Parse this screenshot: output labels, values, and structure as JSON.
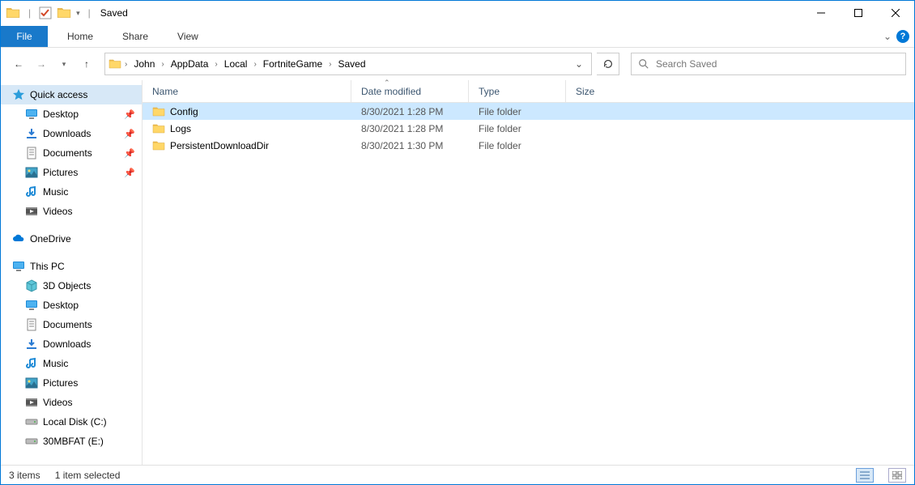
{
  "titlebar": {
    "title": "Saved",
    "sep": "|"
  },
  "ribbon": {
    "file": "File",
    "tabs": [
      "Home",
      "Share",
      "View"
    ]
  },
  "breadcrumb": [
    "John",
    "AppData",
    "Local",
    "FortniteGame",
    "Saved"
  ],
  "search": {
    "placeholder": "Search Saved"
  },
  "navpane": {
    "quick_access": "Quick access",
    "quick_items": [
      {
        "label": "Desktop",
        "icon": "desktop",
        "pinned": true
      },
      {
        "label": "Downloads",
        "icon": "downloads",
        "pinned": true
      },
      {
        "label": "Documents",
        "icon": "documents",
        "pinned": true
      },
      {
        "label": "Pictures",
        "icon": "pictures",
        "pinned": true
      },
      {
        "label": "Music",
        "icon": "music",
        "pinned": false
      },
      {
        "label": "Videos",
        "icon": "videos",
        "pinned": false
      }
    ],
    "onedrive": "OneDrive",
    "this_pc": "This PC",
    "pc_items": [
      {
        "label": "3D Objects",
        "icon": "3d"
      },
      {
        "label": "Desktop",
        "icon": "desktop"
      },
      {
        "label": "Documents",
        "icon": "documents"
      },
      {
        "label": "Downloads",
        "icon": "downloads"
      },
      {
        "label": "Music",
        "icon": "music"
      },
      {
        "label": "Pictures",
        "icon": "pictures"
      },
      {
        "label": "Videos",
        "icon": "videos"
      },
      {
        "label": "Local Disk (C:)",
        "icon": "disk"
      },
      {
        "label": "30MBFAT (E:)",
        "icon": "disk"
      }
    ]
  },
  "columns": {
    "name": "Name",
    "date": "Date modified",
    "type": "Type",
    "size": "Size"
  },
  "rows": [
    {
      "name": "Config",
      "date": "8/30/2021 1:28 PM",
      "type": "File folder",
      "size": "",
      "selected": true
    },
    {
      "name": "Logs",
      "date": "8/30/2021 1:28 PM",
      "type": "File folder",
      "size": "",
      "selected": false
    },
    {
      "name": "PersistentDownloadDir",
      "date": "8/30/2021 1:30 PM",
      "type": "File folder",
      "size": "",
      "selected": false
    }
  ],
  "status": {
    "items": "3 items",
    "selection": "1 item selected"
  }
}
